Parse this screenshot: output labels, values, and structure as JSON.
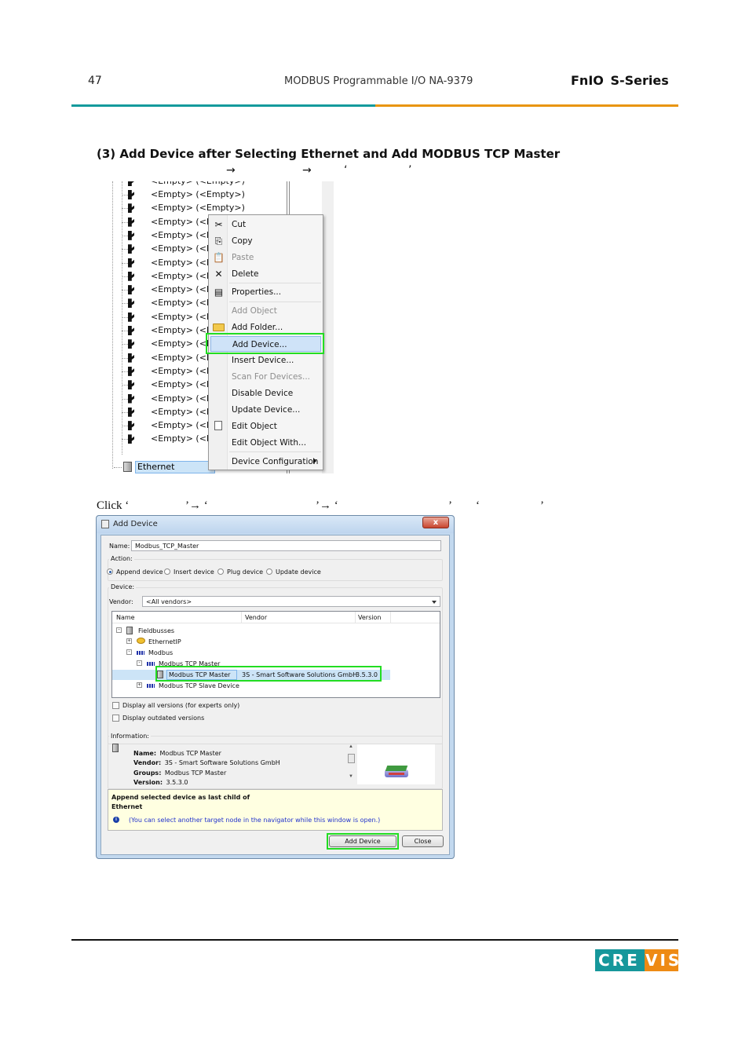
{
  "header": {
    "page_number": "47",
    "doc_title": "MODBUS Programmable I/O NA-9379",
    "brand": "FnIO  S-Series",
    "colors": {
      "teal": "#149a9c",
      "orange": "#e9950e"
    }
  },
  "section": {
    "title": "(3) Add Device after Selecting Ethernet and Add MODBUS TCP Master",
    "instruction_arrows": [
      "→",
      "→",
      "‘",
      "’"
    ]
  },
  "tree": {
    "partial_top_row": "<Empty> (<Empty>)",
    "rows": [
      "<Empty> (<Empty>)",
      "<Empty> (<Empty>)",
      "<Empty> (<Emp",
      "<Empty> (<Emp",
      "<Empty> (<Emp",
      "<Empty> (<Emp",
      "<Empty> (<Emp",
      "<Empty> (<Emp",
      "<Empty> (<Emp",
      "<Empty> (<Emp",
      "<Empty> (<Emp",
      "<Empty> (<Emp",
      "<Empty> (<Emp",
      "<Empty> (<Emp",
      "<Empty> (<Emp",
      "<Empty> (<Emp",
      "<Empty> (<Emp",
      "<Empty> (<Emp",
      "<Empty> (<Emp"
    ],
    "selected_node": "Ethernet (Ethernet)"
  },
  "context_menu": {
    "items": [
      {
        "label": "Cut",
        "icon": "scissors-icon",
        "glyph": "✂",
        "disabled": false
      },
      {
        "label": "Copy",
        "icon": "copy-icon",
        "glyph": "⎘",
        "disabled": false
      },
      {
        "label": "Paste",
        "icon": "paste-icon",
        "glyph": "📋",
        "disabled": true
      },
      {
        "label": "Delete",
        "icon": "delete-icon",
        "glyph": "✕",
        "disabled": false
      },
      {
        "label": "Properties...",
        "icon": "properties-icon",
        "glyph": "▤",
        "disabled": false
      },
      {
        "label": "Add Object",
        "icon": "add-object-icon",
        "glyph": "",
        "disabled": true
      },
      {
        "label": "Add Folder...",
        "icon": "folder-icon",
        "glyph": "",
        "disabled": false
      },
      {
        "label": "Add Device...",
        "icon": "",
        "glyph": "",
        "disabled": false,
        "highlighted": true
      },
      {
        "label": "Insert Device...",
        "icon": "",
        "glyph": "",
        "disabled": false
      },
      {
        "label": "Scan For Devices...",
        "icon": "",
        "glyph": "",
        "disabled": true
      },
      {
        "label": "Disable Device",
        "icon": "",
        "glyph": "",
        "disabled": false
      },
      {
        "label": "Update Device...",
        "icon": "",
        "glyph": "",
        "disabled": false
      },
      {
        "label": "Edit Object",
        "icon": "edit-object-icon",
        "glyph": "",
        "disabled": false
      },
      {
        "label": "Edit Object With...",
        "icon": "",
        "glyph": "",
        "disabled": false
      },
      {
        "label": "Device Configuration",
        "icon": "",
        "glyph": "",
        "disabled": false,
        "submenu": true
      }
    ]
  },
  "click_line": {
    "prefix": "Click ‘",
    "parts": [
      "’→ ‘",
      "’→ ‘",
      "’",
      "‘",
      "’"
    ]
  },
  "dialog": {
    "title": "Add Device",
    "close_glyph": "x",
    "name_label": "Name:",
    "name_value": "Modbus_TCP_Master",
    "action_label": "Action:",
    "actions": [
      {
        "label": "Append device",
        "selected": true
      },
      {
        "label": "Insert device",
        "selected": false
      },
      {
        "label": "Plug device",
        "selected": false
      },
      {
        "label": "Update device",
        "selected": false
      }
    ],
    "device_label": "Device:",
    "vendor_label": "Vendor:",
    "vendor_value": "<All vendors>",
    "columns": [
      "Name",
      "Vendor",
      "Version"
    ],
    "tree": [
      {
        "label": "Fieldbusses",
        "expander": "−",
        "level": 0
      },
      {
        "label": "EthernetIP",
        "expander": "+",
        "level": 1
      },
      {
        "label": "Modbus",
        "expander": "−",
        "level": 1
      },
      {
        "label": "Modbus TCP Master",
        "expander": "−",
        "level": 2
      },
      {
        "label": "Modbus TCP Master",
        "vendor": "3S - Smart Software Solutions GmbH",
        "version": "3.5.3.0",
        "level": 3,
        "selected": true
      },
      {
        "label": "Modbus TCP Slave Device",
        "expander": "+",
        "level": 2
      }
    ],
    "checkboxes": [
      {
        "label": "Display all versions (for experts only)",
        "checked": false
      },
      {
        "label": "Display outdated versions",
        "checked": false
      }
    ],
    "information_label": "Information:",
    "info": [
      {
        "key": "Name:",
        "value": "Modbus TCP Master"
      },
      {
        "key": "Vendor:",
        "value": "3S - Smart Software Solutions GmbH"
      },
      {
        "key": "Groups:",
        "value": "Modbus TCP Master"
      },
      {
        "key": "Version:",
        "value": "3.5.3.0"
      }
    ],
    "append_line1": "Append selected device as last child of",
    "append_line2": "Ethernet",
    "hint": "(You can select another target node in the navigator while this window is open.)",
    "add_button": "Add Device",
    "close_button": "Close",
    "highlight_color": "#22dd22"
  },
  "footer": {
    "logo_left": "CRE",
    "logo_right": "VIS",
    "logo_colors": {
      "teal": "#16979b",
      "orange": "#ee8a14"
    }
  }
}
